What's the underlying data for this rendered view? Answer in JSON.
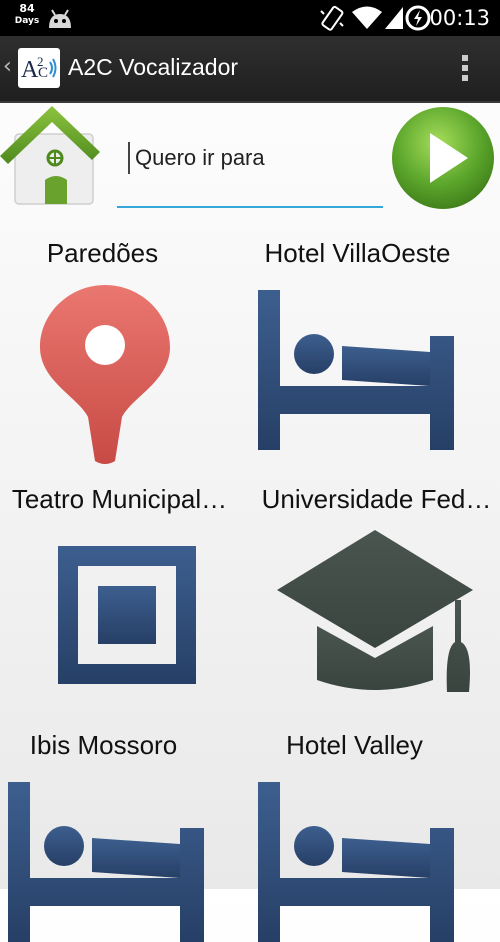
{
  "status_bar": {
    "days_count": "84",
    "days_label": "Days",
    "time": "00:13",
    "icons": [
      "android-icon",
      "vibrate-icon",
      "wifi-icon",
      "signal-icon",
      "battery-charging-icon"
    ]
  },
  "action_bar": {
    "title": "A2C Vocalizador",
    "logo_text": "A2C",
    "menu_icon": "overflow-menu-icon"
  },
  "controls": {
    "home_icon": "home-icon",
    "phrase": "Quero ir para",
    "play_icon": "play-icon"
  },
  "tiles": [
    {
      "label": "Paredões",
      "icon": "map-pin-icon"
    },
    {
      "label": "Hotel VillaOeste",
      "icon": "hotel-bed-icon"
    },
    {
      "label": "Teatro Municipal…",
      "icon": "square-frame-icon"
    },
    {
      "label": "Universidade Fed…",
      "icon": "graduation-cap-icon"
    },
    {
      "label": "Ibis Mossoro",
      "icon": "hotel-bed-icon"
    },
    {
      "label": "Hotel Valley",
      "icon": "hotel-bed-icon"
    }
  ],
  "colors": {
    "accent": "#33a7d8",
    "icon_blue": "#2f4f7f",
    "pin_red": "#e46b67",
    "cap_gray": "#4b5550",
    "play_green": "#5aa52b",
    "home_green": "#6aa22e"
  }
}
